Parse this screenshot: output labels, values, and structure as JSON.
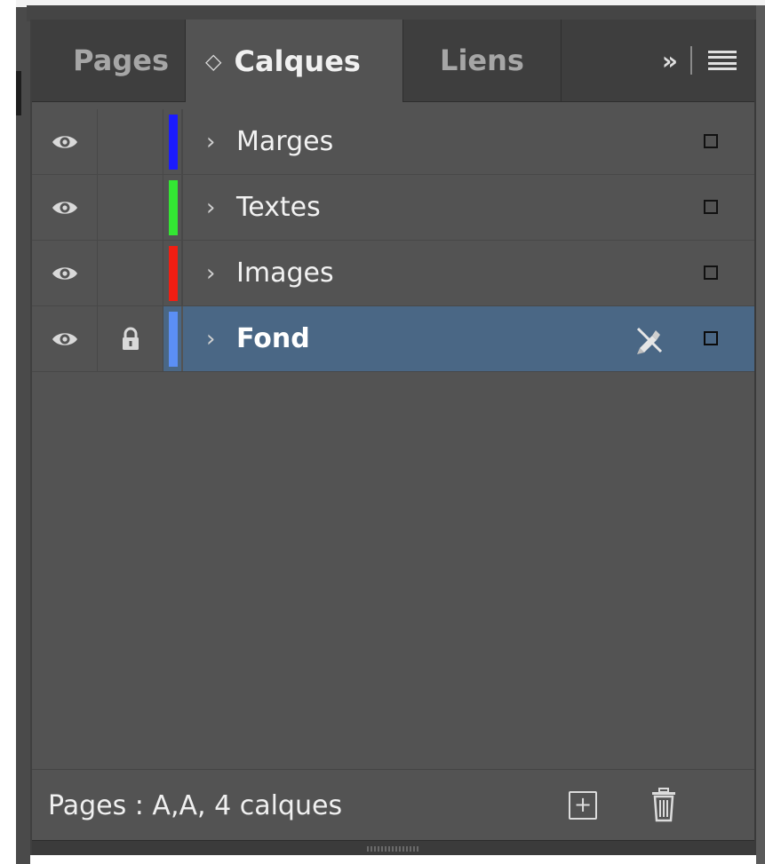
{
  "tabs": [
    {
      "label": "Pages",
      "active": false
    },
    {
      "label": "Calques",
      "active": true
    },
    {
      "label": "Liens",
      "active": false
    }
  ],
  "tab_active_indicator": "◇",
  "toolbar": {
    "overflow_label": "»",
    "overflow_icon": "chevron-double-right-icon",
    "menu_icon": "hamburger-menu-icon"
  },
  "layers": [
    {
      "name": "Marges",
      "color": "#1b1bff",
      "visible": true,
      "locked": false,
      "selected": false
    },
    {
      "name": "Textes",
      "color": "#33e633",
      "visible": true,
      "locked": false,
      "selected": false
    },
    {
      "name": "Images",
      "color": "#f21e12",
      "visible": true,
      "locked": false,
      "selected": false
    },
    {
      "name": "Fond",
      "color": "#5b8ff5",
      "visible": true,
      "locked": true,
      "selected": true
    }
  ],
  "footer": {
    "status": "Pages : A,A, 4 calques",
    "new_layer_icon": "new-layer-icon",
    "delete_icon": "trash-icon"
  },
  "colors": {
    "panel_bg": "#535353",
    "tabbar_bg": "#3e3e3e",
    "selection_bg": "#4a6785"
  }
}
